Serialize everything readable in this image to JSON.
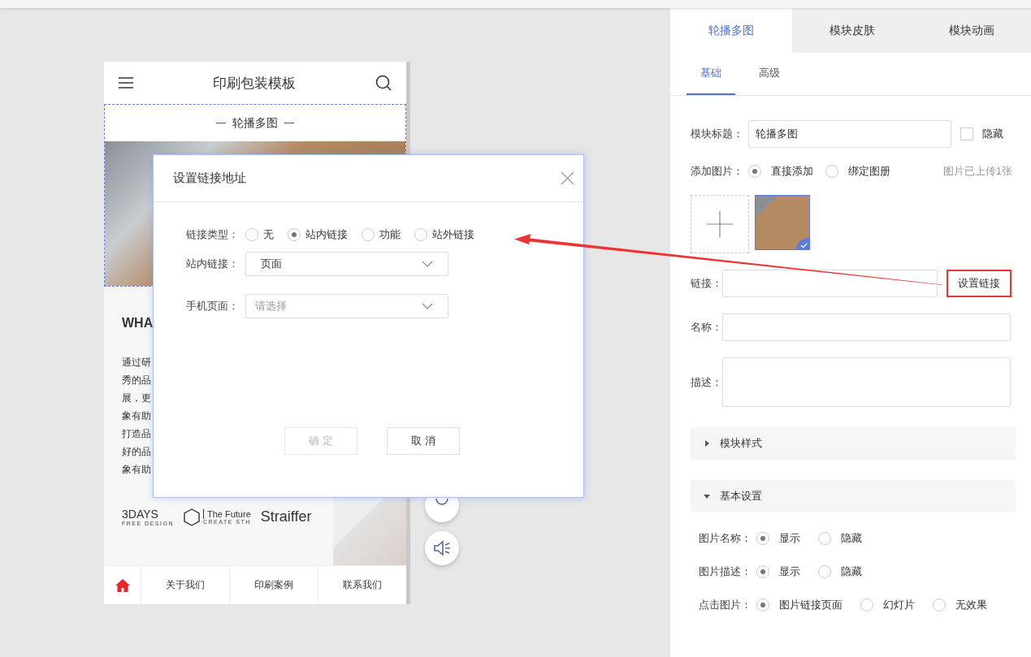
{
  "phone": {
    "title": "印刷包装模板",
    "module_label": "轮播多图",
    "heading": "WHA",
    "paragraph_lines": [
      "通过研",
      "秀的品",
      "展，更",
      "象有助",
      "打造品",
      "好的品",
      "象有助"
    ],
    "logos": [
      {
        "name": "3DAYS",
        "sub": "FREE DESIGN"
      },
      {
        "name": "The Future",
        "sub": "CREATE STH"
      },
      {
        "name": "Straiffer"
      }
    ],
    "nav": [
      {
        "kind": "home",
        "selected": true
      },
      {
        "kind": "text",
        "label": "关于我们",
        "selected": false
      },
      {
        "kind": "text",
        "label": "印刷案例",
        "selected": false
      },
      {
        "kind": "text",
        "label": "联系我们",
        "selected": false
      }
    ]
  },
  "dialog": {
    "title": "设置链接地址",
    "link_type": {
      "label": "链接类型：",
      "options": [
        {
          "label": "无",
          "selected": false
        },
        {
          "label": "站内链接",
          "selected": true
        },
        {
          "label": "功能",
          "selected": false
        },
        {
          "label": "站外链接",
          "selected": false
        }
      ]
    },
    "selects": [
      {
        "label": "站内链接：",
        "value": "页面"
      },
      {
        "label": "手机页面：",
        "placeholder": "请选择"
      }
    ],
    "buttons": [
      {
        "label": "确 定",
        "disabled": true
      },
      {
        "label": "取 消",
        "disabled": false
      }
    ]
  },
  "panel": {
    "tabs": [
      {
        "label": "轮播多图",
        "selected": true
      },
      {
        "label": "模块皮肤",
        "selected": false
      },
      {
        "label": "模块动画",
        "selected": false
      }
    ],
    "subtabs": [
      {
        "label": "基础",
        "selected": true
      },
      {
        "label": "高级",
        "selected": false
      }
    ],
    "module_title": {
      "label": "模块标题：",
      "value": "轮播多图",
      "hide_label": "隐藏",
      "hidden": false
    },
    "add_image": {
      "label": "添加图片：",
      "options": [
        {
          "label": "直接添加",
          "selected": true
        },
        {
          "label": "绑定图册",
          "selected": false
        }
      ],
      "note": "图片已上传1张"
    },
    "images": [
      {
        "selected": true
      }
    ],
    "link": {
      "label": "链接：",
      "button": "设置链接",
      "highlighted": true
    },
    "name": {
      "label": "名称："
    },
    "description": {
      "label": "描述："
    },
    "sections": [
      {
        "label": "模块样式",
        "expanded": false
      },
      {
        "label": "基本设置",
        "expanded": true
      }
    ],
    "settings": [
      {
        "label": "图片名称：",
        "options": [
          {
            "label": "显示",
            "selected": true
          },
          {
            "label": "隐藏",
            "selected": false
          }
        ]
      },
      {
        "label": "图片描述：",
        "options": [
          {
            "label": "显示",
            "selected": true
          },
          {
            "label": "隐藏",
            "selected": false
          }
        ]
      },
      {
        "label": "点击图片：",
        "options": [
          {
            "label": "图片链接页面",
            "selected": true
          },
          {
            "label": "幻灯片",
            "selected": false
          },
          {
            "label": "无效果",
            "selected": false
          }
        ]
      }
    ]
  }
}
